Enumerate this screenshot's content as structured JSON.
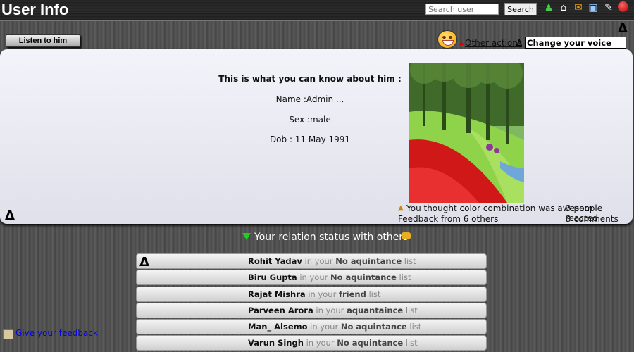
{
  "app_title": "User Info",
  "search": {
    "placeholder": "Search user",
    "button_label": "Search"
  },
  "toolbar_icons": [
    "users-icon",
    "home-icon",
    "mail-icon",
    "screen-icon",
    "edit-icon",
    "power-icon"
  ],
  "actions": {
    "listen_label": "Listen to him",
    "other_actions_label": "Other actions",
    "delta_symbol": "Δ",
    "change_voice_label": "Change your voice sample"
  },
  "profile": {
    "heading": "This is what you can know about him :",
    "name_line": "Name :Admin ...",
    "sex_line": "Sex :male",
    "dob_line": "Dob : 11 May 1991"
  },
  "feedback_summary": {
    "thought_text": "You thought color combination was awesom",
    "reacted_text": "3 people reacted",
    "feedback_text": "Feedback from 6 others",
    "comments_text": "3 comments"
  },
  "relation": {
    "heading": "Your relation status with others",
    "rows": [
      {
        "name": "Rohit Yadav",
        "pre": " in your ",
        "status": "No aquintance",
        "post": " list"
      },
      {
        "name": "Biru Gupta",
        "pre": " in your ",
        "status": "No aquintance",
        "post": " list"
      },
      {
        "name": "Rajat Mishra",
        "pre": " in your ",
        "status": "friend",
        "post": " list"
      },
      {
        "name": "Parveen Arora",
        "pre": " in your ",
        "status": "aquantaince",
        "post": " list"
      },
      {
        "name": "Man_ Alsemo",
        "pre": " in your ",
        "status": "No aquintance",
        "post": " list"
      },
      {
        "name": "Varun Singh",
        "pre": " in your ",
        "status": "No aquintance",
        "post": " list"
      }
    ]
  },
  "give_feedback_label": "Give your feedback"
}
